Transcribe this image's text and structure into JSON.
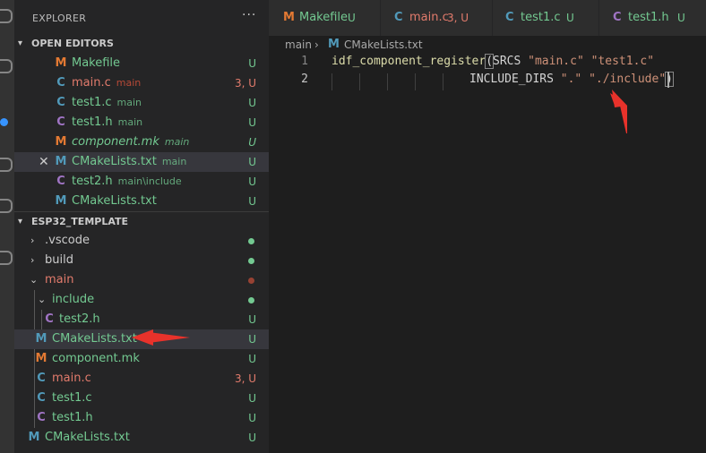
{
  "explorer": {
    "title": "EXPLORER",
    "more": "···",
    "open_editors": {
      "header": "OPEN EDITORS",
      "items": [
        {
          "icon": "M",
          "name": "Makefile",
          "desc": "",
          "status": "U"
        },
        {
          "icon": "C",
          "name": "main.c",
          "desc": "main",
          "status": "3, U"
        },
        {
          "icon": "C",
          "name": "test1.c",
          "desc": "main",
          "status": "U"
        },
        {
          "icon": "C",
          "name": "test1.h",
          "desc": "main",
          "status": "U"
        },
        {
          "icon": "M",
          "name": "component.mk",
          "desc": "main",
          "status": "U"
        },
        {
          "icon": "M",
          "name": "CMakeLists.txt",
          "desc": "main",
          "status": "U",
          "close": "✕"
        },
        {
          "icon": "C",
          "name": "test2.h",
          "desc": "main\\include",
          "status": "U"
        },
        {
          "icon": "M",
          "name": "CMakeLists.txt",
          "desc": "",
          "status": "U"
        }
      ]
    },
    "workspace": {
      "header": "ESP32_TEMPLATE",
      "items": [
        {
          "name": ".vscode",
          "status": "",
          "dot": "#73c991"
        },
        {
          "name": "build",
          "status": "",
          "dot": "#73c991"
        },
        {
          "name": "main",
          "status": "",
          "dot": "#c74e39"
        },
        {
          "name": "include",
          "status": "",
          "dot": "#73c991"
        },
        {
          "icon": "C",
          "name": "test2.h",
          "status": "U"
        },
        {
          "icon": "M",
          "name": "CMakeLists.txt",
          "status": "U"
        },
        {
          "icon": "M",
          "name": "component.mk",
          "status": "U"
        },
        {
          "icon": "C",
          "name": "main.c",
          "status": "3, U"
        },
        {
          "icon": "C",
          "name": "test1.c",
          "status": "U"
        },
        {
          "icon": "C",
          "name": "test1.h",
          "status": "U"
        },
        {
          "icon": "M",
          "name": "CMakeLists.txt",
          "status": "U"
        }
      ]
    }
  },
  "tabs": [
    {
      "icon": "M",
      "label": "Makefile",
      "status": "U"
    },
    {
      "icon": "C",
      "label": "main.c",
      "status": "3, U"
    },
    {
      "icon": "C",
      "label": "test1.c",
      "status": "U"
    },
    {
      "icon": "C",
      "label": "test1.h",
      "status": "U"
    }
  ],
  "breadcrumb": {
    "folder": "main",
    "sep": "›",
    "icon": "M",
    "file": "CMakeLists.txt"
  },
  "editor": {
    "line_numbers": [
      "1",
      "2"
    ],
    "line1": {
      "fn": "idf_component_register",
      "paren": "(",
      "kw": "SRCS ",
      "s1": "\"main.c\"",
      "sp": " ",
      "s2": "\"test1.c\""
    },
    "line2": {
      "kw": "INCLUDE_DIRS ",
      "s1": "\".\"",
      "sp": " ",
      "s2": "\"./include\"",
      "paren": ")"
    }
  },
  "colors": {
    "accent_red_arrow": "#e8322b",
    "untracked_green": "#73c991",
    "modified_red": "#e27b6c"
  }
}
